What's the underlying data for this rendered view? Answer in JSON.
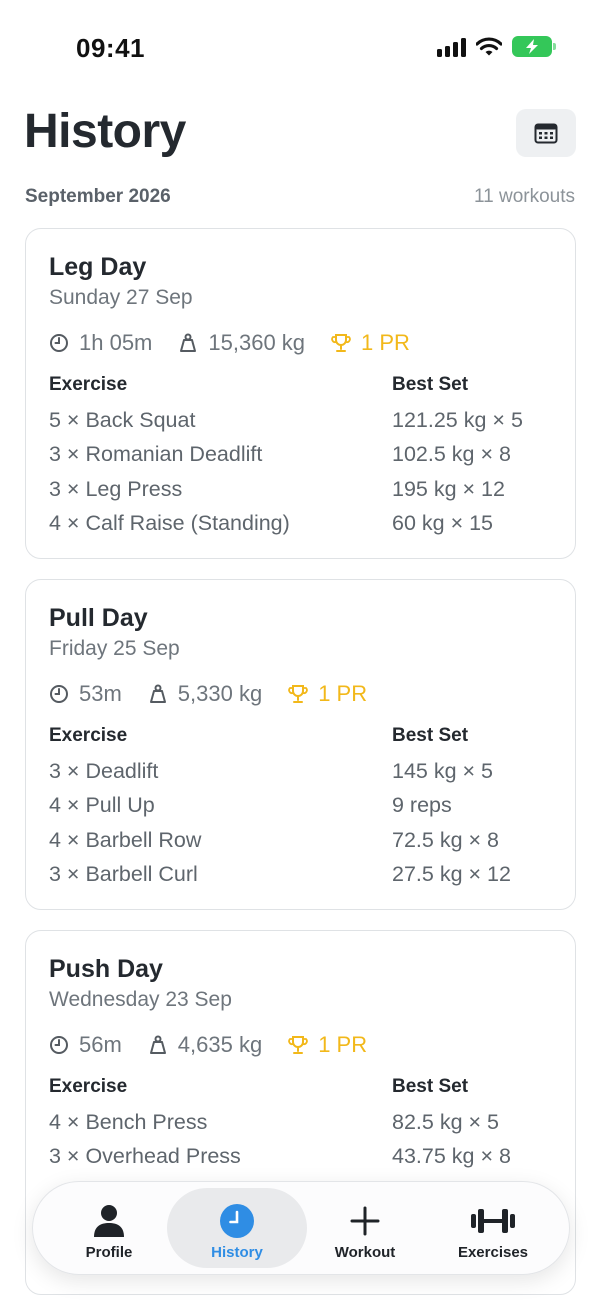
{
  "status_bar": {
    "time": "09:41"
  },
  "header": {
    "title": "History",
    "calendar_icon": "calendar-icon",
    "month": "September 2026",
    "workout_count": "11 workouts"
  },
  "workouts": [
    {
      "title": "Leg Day",
      "date": "Sunday 27 Sep",
      "duration": "1h 05m",
      "volume": "15,360 kg",
      "pr": "1 PR",
      "col_exercise": "Exercise",
      "col_best": "Best Set",
      "exercises": [
        {
          "name": "5 × Back Squat",
          "best": "121.25 kg × 5"
        },
        {
          "name": "3 × Romanian Deadlift",
          "best": "102.5 kg × 8"
        },
        {
          "name": "3 × Leg Press",
          "best": "195 kg × 12"
        },
        {
          "name": "4 × Calf Raise (Standing)",
          "best": "60 kg × 15"
        }
      ]
    },
    {
      "title": "Pull Day",
      "date": "Friday 25 Sep",
      "duration": "53m",
      "volume": "5,330 kg",
      "pr": "1 PR",
      "col_exercise": "Exercise",
      "col_best": "Best Set",
      "exercises": [
        {
          "name": "3 × Deadlift",
          "best": "145 kg × 5"
        },
        {
          "name": "4 × Pull Up",
          "best": "9 reps"
        },
        {
          "name": "4 × Barbell Row",
          "best": "72.5 kg × 8"
        },
        {
          "name": "3 × Barbell Curl",
          "best": "27.5 kg × 12"
        }
      ]
    },
    {
      "title": "Push Day",
      "date": "Wednesday 23 Sep",
      "duration": "56m",
      "volume": "4,635 kg",
      "pr": "1 PR",
      "col_exercise": "Exercise",
      "col_best": "Best Set",
      "exercises": [
        {
          "name": "4 × Bench Press",
          "best": "82.5 kg × 5"
        },
        {
          "name": "3 × Overhead Press",
          "best": "43.75 kg × 8"
        }
      ]
    }
  ],
  "tabbar": {
    "items": [
      {
        "label": "Profile",
        "icon": "person-icon"
      },
      {
        "label": "History",
        "icon": "clock-icon",
        "active": true
      },
      {
        "label": "Workout",
        "icon": "plus-icon"
      },
      {
        "label": "Exercises",
        "icon": "dumbbell-icon"
      }
    ]
  },
  "colors": {
    "accent": "#2f8de4",
    "pr": "#f2b81a",
    "battery": "#34c759"
  }
}
